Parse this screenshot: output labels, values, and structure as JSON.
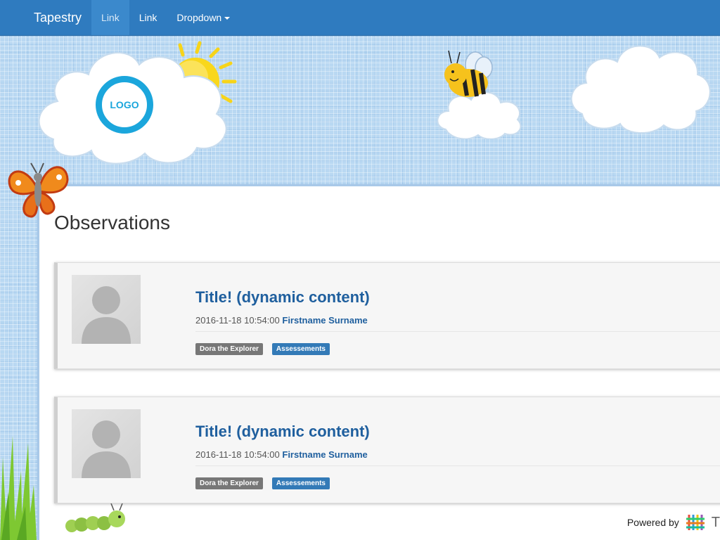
{
  "navbar": {
    "brand": "Tapestry",
    "links": [
      {
        "label": "Link",
        "active": true
      },
      {
        "label": "Link",
        "active": false
      }
    ],
    "dropdown_label": "Dropdown"
  },
  "header": {
    "logo_text": "LOGO"
  },
  "main": {
    "title": "Observations",
    "observations": [
      {
        "title": "Title! (dynamic content)",
        "timestamp": "2016-11-18 10:54:00",
        "author": "Firstname Surname",
        "tags": [
          {
            "label": "Dora the Explorer",
            "color": "#777777"
          },
          {
            "label": "Assessements",
            "color": "#337ab7"
          }
        ]
      },
      {
        "title": "Title! (dynamic content)",
        "timestamp": "2016-11-18 10:54:00",
        "author": "Firstname Surname",
        "tags": [
          {
            "label": "Dora the Explorer",
            "color": "#777777"
          },
          {
            "label": "Assessements",
            "color": "#337ab7"
          }
        ]
      }
    ]
  },
  "footer": {
    "powered_by": "Powered by",
    "brand_letter": "T"
  },
  "colors": {
    "navbar": "#2f7bbf",
    "link": "#1f5f9e",
    "logo_ring": "#1ba6dc",
    "background": "#b9d8f2"
  }
}
